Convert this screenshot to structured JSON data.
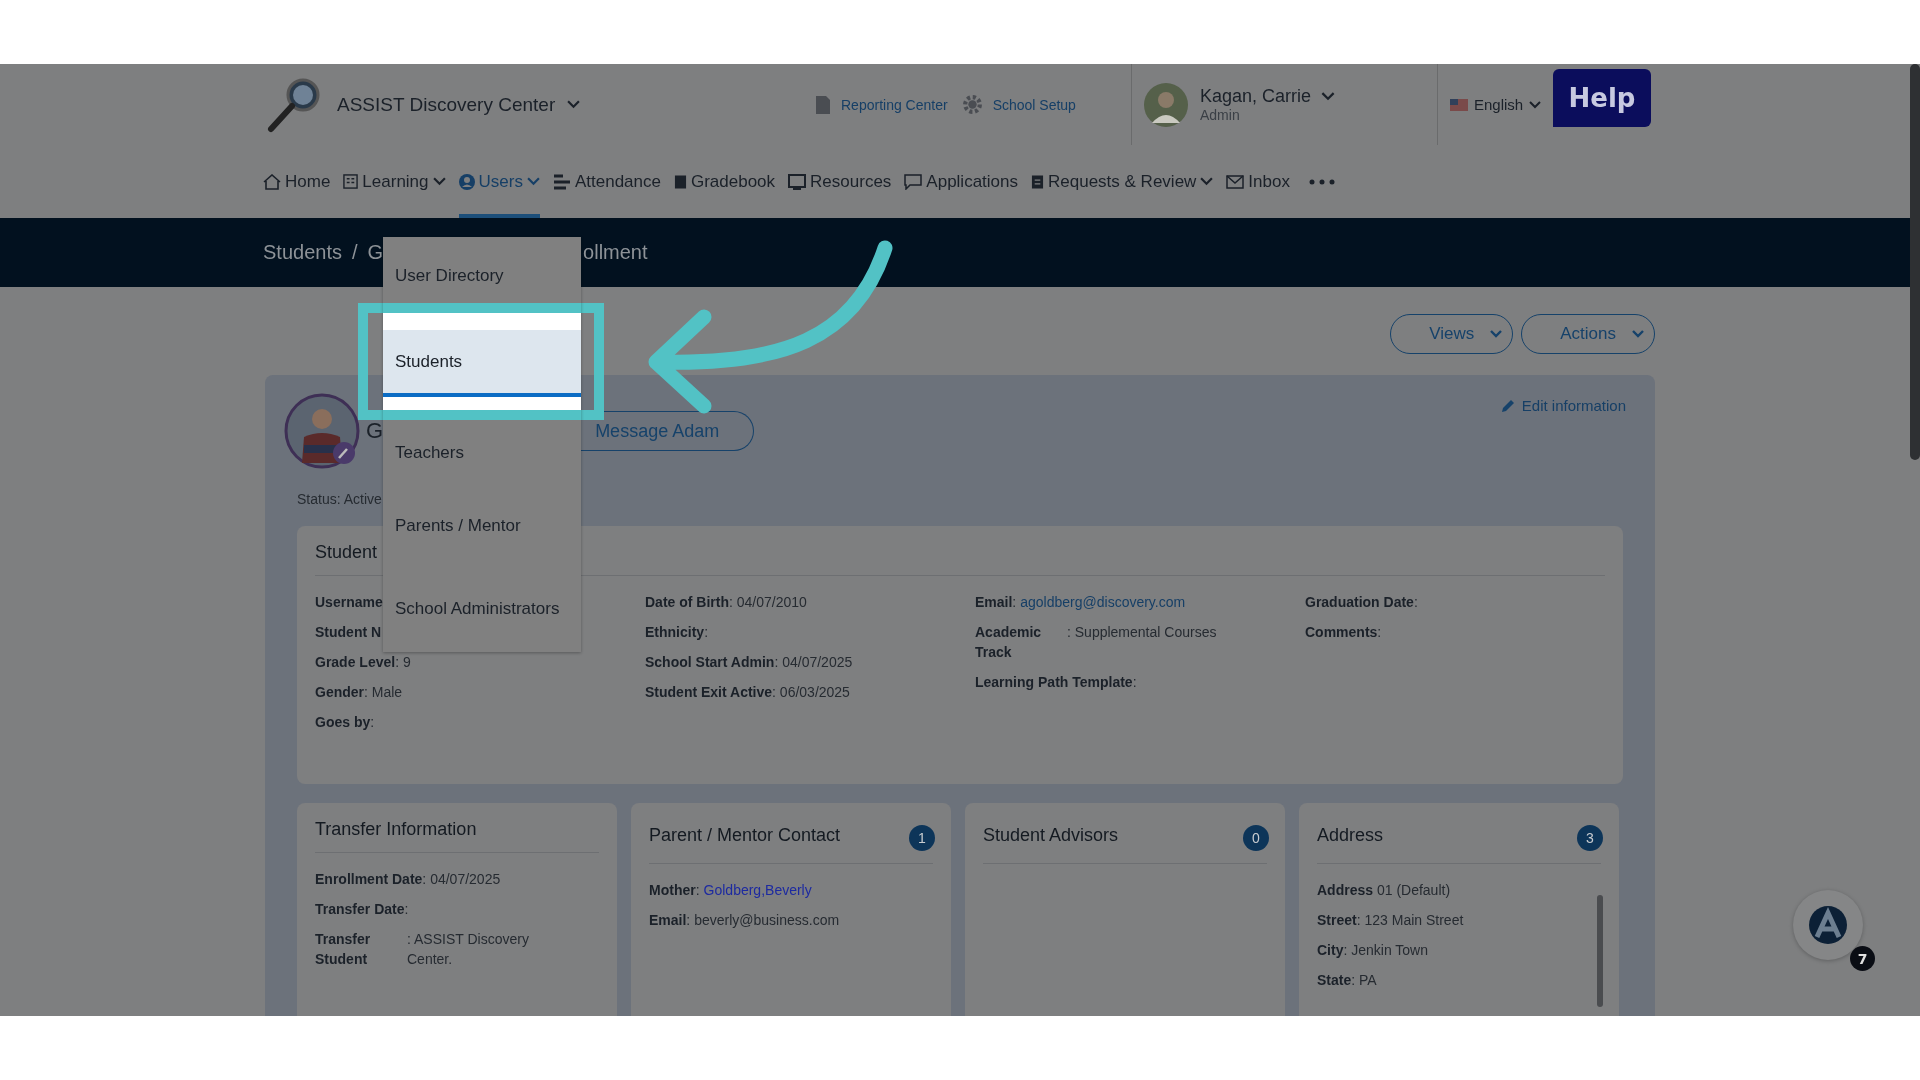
{
  "header": {
    "school": "ASSIST Discovery Center",
    "links": [
      {
        "label": "Reporting Center",
        "kind": "report"
      },
      {
        "label": "School Setup",
        "kind": "setup"
      }
    ],
    "user": {
      "name": "Kagan, Carrie",
      "role": "Admin"
    },
    "language": "English",
    "help": "Help"
  },
  "nav": [
    {
      "label": "Home",
      "kind": "home",
      "menu": false,
      "selected": false
    },
    {
      "label": "Learning",
      "kind": "grid",
      "menu": true,
      "selected": false
    },
    {
      "label": "Users",
      "kind": "user",
      "menu": true,
      "selected": true
    },
    {
      "label": "Attendance",
      "kind": "lines",
      "menu": false,
      "selected": false
    },
    {
      "label": "Gradebook",
      "kind": "book",
      "menu": false,
      "selected": false
    },
    {
      "label": "Resources",
      "kind": "monitor",
      "menu": false,
      "selected": false
    },
    {
      "label": "Applications",
      "kind": "chat",
      "menu": false,
      "selected": false
    },
    {
      "label": "Requests & Review",
      "kind": "doc",
      "menu": true,
      "selected": false
    },
    {
      "label": "Inbox",
      "kind": "mail",
      "menu": false,
      "selected": false
    }
  ],
  "breadcrumb": {
    "before": [
      "Students",
      "/",
      "G"
    ],
    "after": "ollment"
  },
  "dropdown": [
    {
      "label": "User Directory",
      "selected": false
    },
    {
      "label": "Students",
      "selected": true
    },
    {
      "label": "Teachers",
      "selected": false
    },
    {
      "label": "Parents / Mentor",
      "selected": false
    },
    {
      "label": "School Administrators",
      "selected": false
    }
  ],
  "toolbar": [
    "Views",
    "Actions"
  ],
  "profile": {
    "name": "G",
    "message_button": "Message Adam",
    "edit": "Edit information",
    "status": "Status: Active"
  },
  "student_card": {
    "title": "Student",
    "columns": [
      [
        {
          "kind": "text",
          "text": "**Username**"
        },
        {
          "kind": "text",
          "text": "**Student N**"
        },
        {
          "kind": "text",
          "text": "**Grade Level**: 9"
        },
        {
          "kind": "text",
          "text": "**Gender**: Male"
        },
        {
          "kind": "text",
          "text": "**Goes by**:"
        }
      ],
      [
        {
          "kind": "text",
          "text": "**Date of Birth**: 04/07/2010"
        },
        {
          "kind": "text",
          "text": "**Ethnicity**:"
        },
        {
          "kind": "text",
          "text": "**School Start Admin**: 04/07/2025"
        },
        {
          "kind": "text",
          "text": "**Student Exit Active**: 06/03/2025"
        }
      ],
      [
        {
          "kind": "link",
          "text": "**Email**:",
          "link": "agoldberg@discovery.com"
        },
        {
          "kind": "split",
          "label": "Academic Track",
          "value": ": Supplemental Courses"
        },
        {
          "kind": "text",
          "text": "**Learning Path Template**:"
        }
      ],
      [
        {
          "kind": "text",
          "text": "**Graduation Date**:"
        },
        {
          "kind": "text",
          "text": "**Comments**:"
        }
      ]
    ]
  },
  "cards": [
    {
      "title": "Transfer Information",
      "fields": [
        {
          "kind": "text",
          "text": "**Enrollment Date**: 04/07/2025"
        },
        {
          "kind": "text",
          "text": "**Transfer Date**:"
        },
        {
          "kind": "split",
          "label": "Transfer Student",
          "value": ": ASSIST Discovery Center."
        }
      ]
    },
    {
      "title": "Parent / Mentor Contact",
      "count": "1",
      "fields": [
        {
          "kind": "link",
          "text": "**Mother**:",
          "link": "Goldberg,Beverly"
        },
        {
          "kind": "text",
          "text": "**Email**: beverly@business.com"
        }
      ]
    },
    {
      "title": "Student Advisors",
      "count": "0"
    },
    {
      "title": "Address",
      "count": "3",
      "fields": [
        {
          "kind": "text",
          "text": "**Address** 01 (Default)"
        },
        {
          "kind": "text",
          "text": "**Street**: 123 Main Street"
        },
        {
          "kind": "text",
          "text": "**City**: Jenkin Town"
        },
        {
          "kind": "text",
          "text": "**State**: PA"
        }
      ]
    }
  ],
  "chat_badge": "7"
}
